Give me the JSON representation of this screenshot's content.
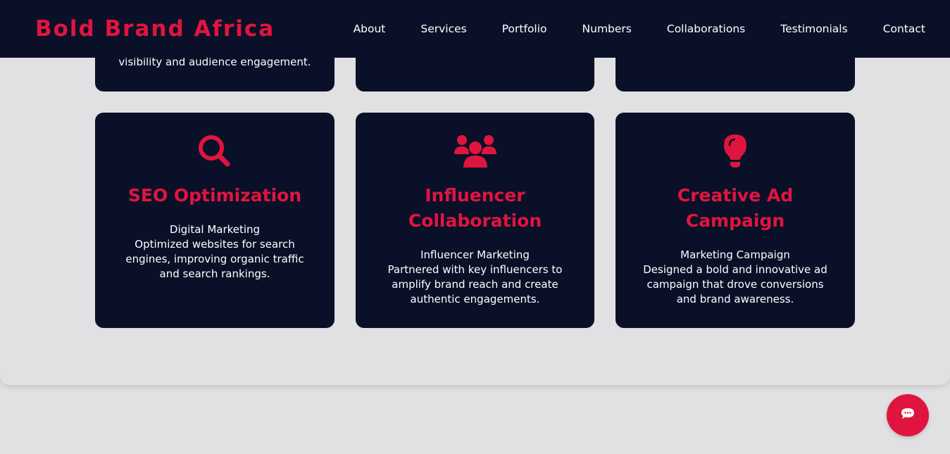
{
  "brand": {
    "name": "Bold Brand Africa",
    "color": "#e0153f"
  },
  "nav": {
    "items": [
      {
        "label": "About"
      },
      {
        "label": "Services"
      },
      {
        "label": "Portfolio"
      },
      {
        "label": "Numbers"
      },
      {
        "label": "Collaborations"
      },
      {
        "label": "Testimonials"
      },
      {
        "label": "Contact"
      }
    ]
  },
  "portfolio": {
    "top_row": [
      {
        "snippet": "visibility and audience engagement."
      },
      {
        "snippet": ""
      },
      {
        "snippet": ""
      }
    ],
    "cards": [
      {
        "icon": "search-icon",
        "title": "SEO Optimization",
        "category": "Digital Marketing",
        "description": "Optimized websites for search engines, improving organic traffic and search rankings."
      },
      {
        "icon": "users-icon",
        "title": "Influencer Collaboration",
        "category": "Influencer Marketing",
        "description": "Partnered with key influencers to amplify brand reach and create authentic engagements."
      },
      {
        "icon": "lightbulb-icon",
        "title": "Creative Ad Campaign",
        "category": "Marketing Campaign",
        "description": "Designed a bold and innovative ad campaign that drove conversions and brand awareness."
      }
    ]
  },
  "chat": {
    "icon": "chat-icon"
  },
  "colors": {
    "accent": "#e0153f",
    "card_bg": "#0b1029",
    "page_bg": "#e1e1e3"
  }
}
